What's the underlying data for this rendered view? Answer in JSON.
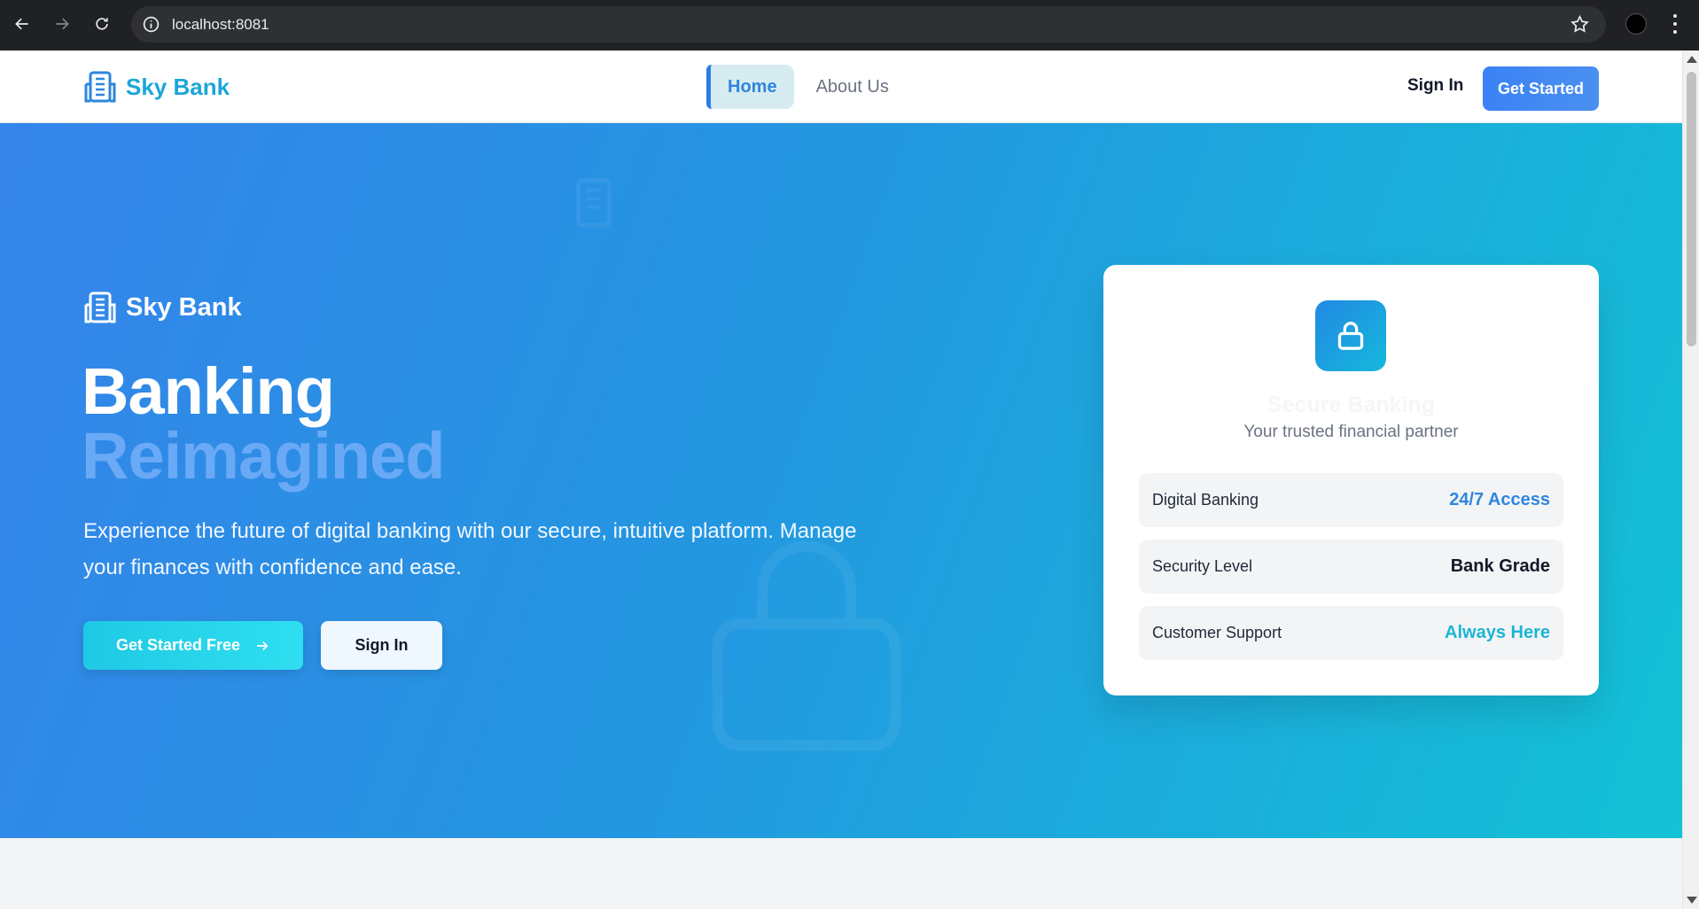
{
  "browser": {
    "url": "localhost:8081"
  },
  "header": {
    "brand_name": "Sky Bank",
    "tabs": [
      {
        "label": "Home"
      },
      {
        "label": "About Us"
      }
    ],
    "sign_in_label": "Sign In",
    "get_started_label": "Get Started"
  },
  "hero": {
    "brand_name": "Sky Bank",
    "title_line1": "Banking",
    "title_line2": "Reimagined",
    "description": "Experience the future of digital banking with our secure, intuitive platform. Manage your finances with confidence and ease.",
    "cta_label": "Get Started Free",
    "sign_in_label": "Sign In"
  },
  "card": {
    "icon": "lock-icon",
    "title": "Secure Banking",
    "subtitle": "Your trusted financial partner",
    "rows": [
      {
        "label": "Digital Banking",
        "value": "24/7 Access",
        "color": "#2e86de"
      },
      {
        "label": "Security Level",
        "value": "Bank Grade",
        "color": "#111827"
      },
      {
        "label": "Customer Support",
        "value": "Always Here",
        "color": "#1cb5d6"
      }
    ]
  },
  "colors": {
    "brand": "#1ba6d9",
    "accent_blue": "#3b82f6",
    "hero_gradient_start": "#3584ea",
    "hero_gradient_end": "#13c2d6"
  }
}
